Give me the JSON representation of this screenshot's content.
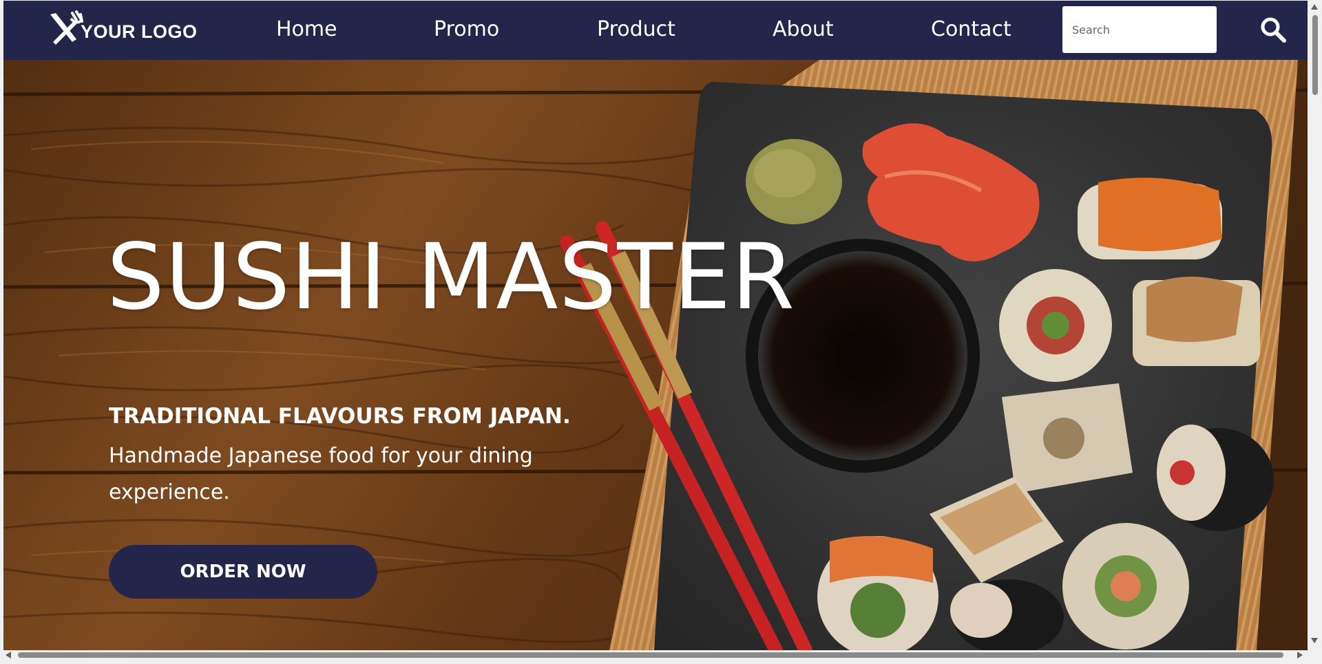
{
  "navbar": {
    "logo_text": "YOUR LOGO",
    "links": [
      "Home",
      "Promo",
      "Product",
      "About",
      "Contact"
    ],
    "search_placeholder": "Search"
  },
  "hero": {
    "title": "SUSHI MASTER",
    "tagline": "TRADITIONAL FLAVOURS FROM JAPAN.",
    "description": "Handmade Japanese food for your dining experience.",
    "cta_label": "ORDER NOW"
  },
  "colors": {
    "navbar": "#23264a",
    "button": "#23264a",
    "text": "#ffffff"
  },
  "icons": {
    "logo": "fork-knife-icon",
    "search": "search-icon"
  }
}
